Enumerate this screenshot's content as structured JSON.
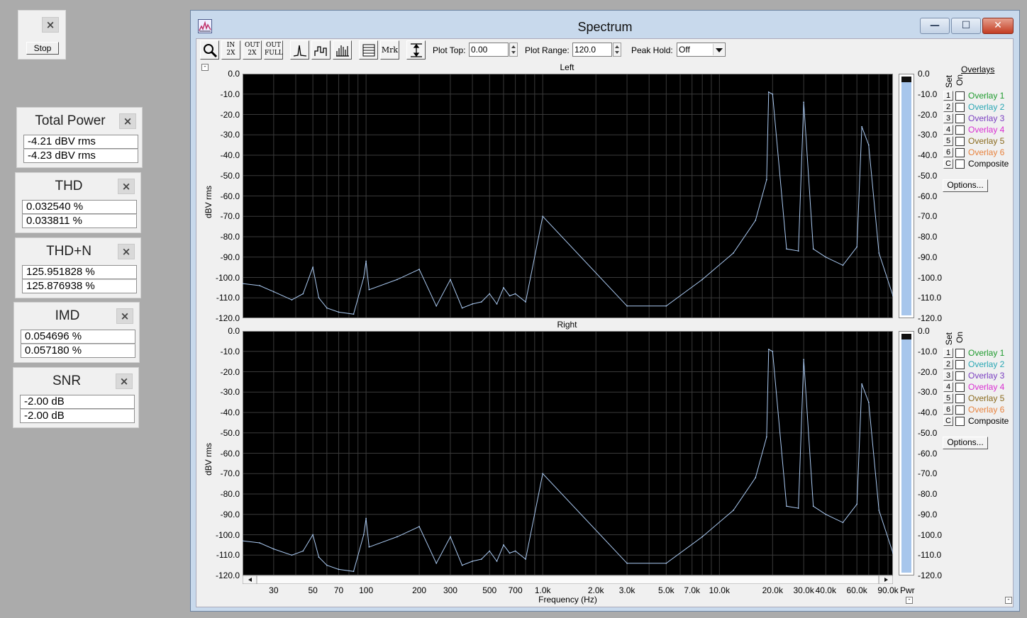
{
  "stop_panel": {
    "stop_label": "Stop"
  },
  "meters": [
    {
      "title": "Total Power",
      "values": [
        "-4.21 dBV rms",
        "-4.23 dBV rms"
      ]
    },
    {
      "title": "THD",
      "values": [
        "0.032540 %",
        "0.033811 %"
      ]
    },
    {
      "title": "THD+N",
      "values": [
        "125.951828 %",
        "125.876938 %"
      ]
    },
    {
      "title": "IMD",
      "values": [
        "0.054696 %",
        "0.057180 %"
      ]
    },
    {
      "title": "SNR",
      "values": [
        "-2.00 dB",
        "-2.00 dB"
      ]
    }
  ],
  "window": {
    "title": "Spectrum",
    "toolbar": {
      "buttons": [
        "zoom-icon",
        "zoom-in-2x-icon",
        "zoom-out-2x-icon",
        "zoom-out-full-icon",
        "line-plot-icon",
        "step-plot-icon",
        "bar-plot-icon",
        "table-icon",
        "Mrk",
        "autoscale-icon"
      ],
      "zoom_in_text": [
        "IN",
        "2X"
      ],
      "zoom_out_text": [
        "OUT",
        "2X"
      ],
      "zoom_full_text": [
        "OUT",
        "FULL"
      ],
      "marker_label": "Mrk",
      "plot_top_label": "Plot Top:",
      "plot_top_value": "0.00",
      "plot_range_label": "Plot Range:",
      "plot_range_value": "120.0",
      "peak_hold_label": "Peak Hold:",
      "peak_hold_value": "Off"
    },
    "overlays": {
      "heading": "Overlays",
      "set_label": "Set",
      "on_label": "On",
      "items": [
        {
          "set": "1",
          "name": "Overlay 1",
          "color": "#1f9b2e"
        },
        {
          "set": "2",
          "name": "Overlay 2",
          "color": "#2aa7b4"
        },
        {
          "set": "3",
          "name": "Overlay 3",
          "color": "#7a3fc1"
        },
        {
          "set": "4",
          "name": "Overlay 4",
          "color": "#d92fd2"
        },
        {
          "set": "5",
          "name": "Overlay 5",
          "color": "#8a6a1e"
        },
        {
          "set": "6",
          "name": "Overlay 6",
          "color": "#e8823d"
        },
        {
          "set": "C",
          "name": "Composite",
          "color": "#000000"
        }
      ],
      "options_label": "Options..."
    },
    "x_axis_label": "Frequency (Hz)",
    "x_tick_labels": [
      "30",
      "50",
      "70",
      "100",
      "200",
      "300",
      "500",
      "700",
      "1.0k",
      "2.0k",
      "3.0k",
      "5.0k",
      "7.0k",
      "10.0k",
      "20.0k",
      "30.0k",
      "40.0k",
      "60.0k",
      "90.0k"
    ],
    "meter_x_label": "Pwr"
  },
  "chart_data": [
    {
      "type": "line",
      "title": "Left",
      "ylabel": "dBV rms",
      "xlabel": "Frequency (Hz)",
      "x_scale": "log",
      "xlim": [
        20,
        96000
      ],
      "ylim": [
        -120,
        0
      ],
      "y_ticks": [
        "0.0",
        "-10.0",
        "-20.0",
        "-30.0",
        "-40.0",
        "-50.0",
        "-60.0",
        "-70.0",
        "-80.0",
        "-90.0",
        "-100.0",
        "-110.0",
        "-120.0"
      ],
      "grid": true,
      "background": "#000000",
      "line_color": "#a9c8f0",
      "series": [
        {
          "x": [
            20,
            25,
            30,
            38,
            44,
            50,
            54,
            60,
            70,
            85,
            97,
            100,
            104,
            150,
            200,
            250,
            300,
            350,
            400,
            450,
            500,
            550,
            600,
            650,
            700,
            800,
            1000,
            3000,
            5000,
            8000,
            12000,
            16000,
            18500,
            19000,
            20000,
            24000,
            28000,
            30000,
            34000,
            40000,
            50000,
            60000,
            64000,
            70000,
            80000,
            96000
          ],
          "y": [
            -103,
            -104,
            -107,
            -111,
            -108,
            -95,
            -110,
            -115,
            -117,
            -118,
            -100,
            -92,
            -106,
            -101,
            -96,
            -114,
            -101,
            -115,
            -113,
            -112,
            -108,
            -113,
            -105,
            -109,
            -108,
            -112,
            -70,
            -114,
            -114,
            -101,
            -88,
            -72,
            -52,
            -9,
            -10,
            -86,
            -87,
            -14,
            -86,
            -90,
            -94,
            -85,
            -26,
            -35,
            -88,
            -109
          ]
        }
      ],
      "meter_level": -3.5
    },
    {
      "type": "line",
      "title": "Right",
      "ylabel": "dBV rms",
      "xlabel": "Frequency (Hz)",
      "x_scale": "log",
      "xlim": [
        20,
        96000
      ],
      "ylim": [
        -120,
        0
      ],
      "y_ticks": [
        "0.0",
        "-10.0",
        "-20.0",
        "-30.0",
        "-40.0",
        "-50.0",
        "-60.0",
        "-70.0",
        "-80.0",
        "-90.0",
        "-100.0",
        "-110.0",
        "-120.0"
      ],
      "grid": true,
      "background": "#000000",
      "line_color": "#a9c8f0",
      "series": [
        {
          "x": [
            20,
            25,
            30,
            38,
            44,
            50,
            54,
            60,
            70,
            85,
            97,
            100,
            104,
            150,
            200,
            250,
            300,
            350,
            400,
            450,
            500,
            550,
            600,
            650,
            700,
            800,
            1000,
            3000,
            5000,
            8000,
            12000,
            16000,
            18500,
            19000,
            20000,
            24000,
            28000,
            30000,
            34000,
            40000,
            50000,
            60000,
            64000,
            70000,
            80000,
            96000
          ],
          "y": [
            -103,
            -104,
            -107,
            -110,
            -108,
            -100,
            -111,
            -115,
            -117,
            -118,
            -100,
            -92,
            -106,
            -101,
            -96,
            -114,
            -101,
            -115,
            -113,
            -112,
            -108,
            -113,
            -105,
            -109,
            -108,
            -112,
            -70,
            -114,
            -114,
            -101,
            -88,
            -72,
            -52,
            -9,
            -10,
            -86,
            -87,
            -14,
            -86,
            -90,
            -94,
            -85,
            -26,
            -35,
            -88,
            -109
          ]
        }
      ],
      "meter_level": -3.5
    }
  ]
}
